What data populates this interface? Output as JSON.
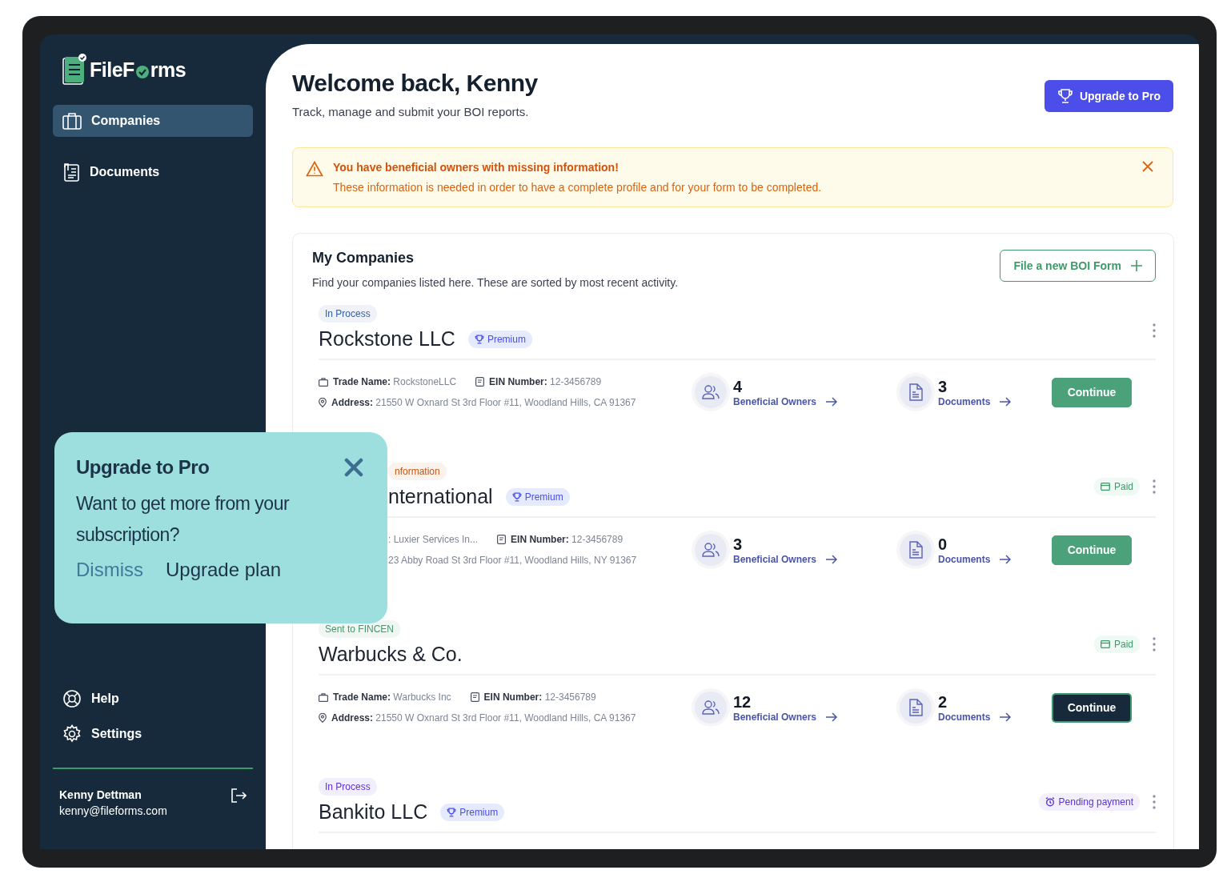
{
  "brand": {
    "name_start": "FileF",
    "name_end": "rms"
  },
  "sidebar": {
    "nav": [
      {
        "label": "Companies",
        "kind": "briefcase",
        "selected": true
      },
      {
        "label": "Documents",
        "kind": "documents",
        "selected": false
      }
    ],
    "footer_nav": [
      {
        "label": "Help",
        "kind": "help"
      },
      {
        "label": "Settings",
        "kind": "settings"
      }
    ],
    "user": {
      "name": "Kenny Dettman",
      "email": "kenny@fileforms.com"
    }
  },
  "header": {
    "title": "Welcome back, Kenny",
    "subtitle": "Track, manage and submit your BOI reports.",
    "upgrade_button": "Upgrade to Pro"
  },
  "alert": {
    "title": "You have beneficial owners with missing information!",
    "message": "These information is needed in order to have a complete profile and for your form to be completed."
  },
  "companies": {
    "title": "My Companies",
    "subtitle": "Find your companies listed here. These are sorted by most recent activity.",
    "new_button": "File a new BOI Form",
    "items": [
      {
        "partly_hidden": false,
        "status": {
          "label": "In Process",
          "color": "#2f5fa8"
        },
        "name": "Rockstone LLC",
        "premium": "Premium",
        "trade": {
          "label": "Trade Name:",
          "value": "RockstoneLLC"
        },
        "ein": {
          "label": "EIN Number:",
          "value": "12-3456789"
        },
        "address": {
          "label": "Address:",
          "value": "21550 W Oxnard St 3rd Floor #11, Woodland Hills, CA 91367"
        },
        "owners": {
          "count": "4",
          "label": "Beneficial Owners"
        },
        "documents": {
          "count": "3",
          "label": "Documents"
        },
        "continue": {
          "label": "Continue",
          "focused": false
        }
      },
      {
        "partly_hidden": true,
        "status": {
          "label": "nformation",
          "color": "#c2571a"
        },
        "name": "nternational",
        "premium": "Premium",
        "payment": {
          "kind": "paid",
          "label": "Paid"
        },
        "trade": {
          "value": ": Luxier Services In..."
        },
        "ein": {
          "label": "EIN Number:",
          "value": "12-3456789"
        },
        "address": {
          "value": "23 Abby Road St 3rd Floor #11, Woodland Hills, NY 91367"
        },
        "owners": {
          "count": "3",
          "label": "Beneficial Owners"
        },
        "documents": {
          "count": "0",
          "label": "Documents"
        },
        "continue": {
          "label": "Continue",
          "focused": false
        }
      },
      {
        "partly_hidden": false,
        "status": {
          "label": "Sent to FINCEN",
          "color": "#3f9a6a"
        },
        "name": "Warbucks & Co.",
        "payment": {
          "kind": "paid",
          "label": "Paid"
        },
        "trade": {
          "label": "Trade Name:",
          "value": "Warbucks Inc"
        },
        "ein": {
          "label": "EIN Number:",
          "value": "12-3456789"
        },
        "address": {
          "label": "Address:",
          "value": "21550 W Oxnard St 3rd Floor #11, Woodland Hills, CA 91367"
        },
        "owners": {
          "count": "12",
          "label": "Beneficial Owners"
        },
        "documents": {
          "count": "2",
          "label": "Documents"
        },
        "continue": {
          "label": "Continue",
          "focused": true
        }
      },
      {
        "partly_hidden": false,
        "status": {
          "label": "In Process",
          "color": "#5b32d6"
        },
        "name": "Bankito LLC",
        "premium": "Premium",
        "payment": {
          "kind": "pending",
          "label": "Pending payment"
        }
      }
    ]
  },
  "promo": {
    "title": "Upgrade to Pro",
    "message": "Want to get more from your subscription?",
    "dismiss": "Dismiss",
    "action": "Upgrade plan"
  }
}
